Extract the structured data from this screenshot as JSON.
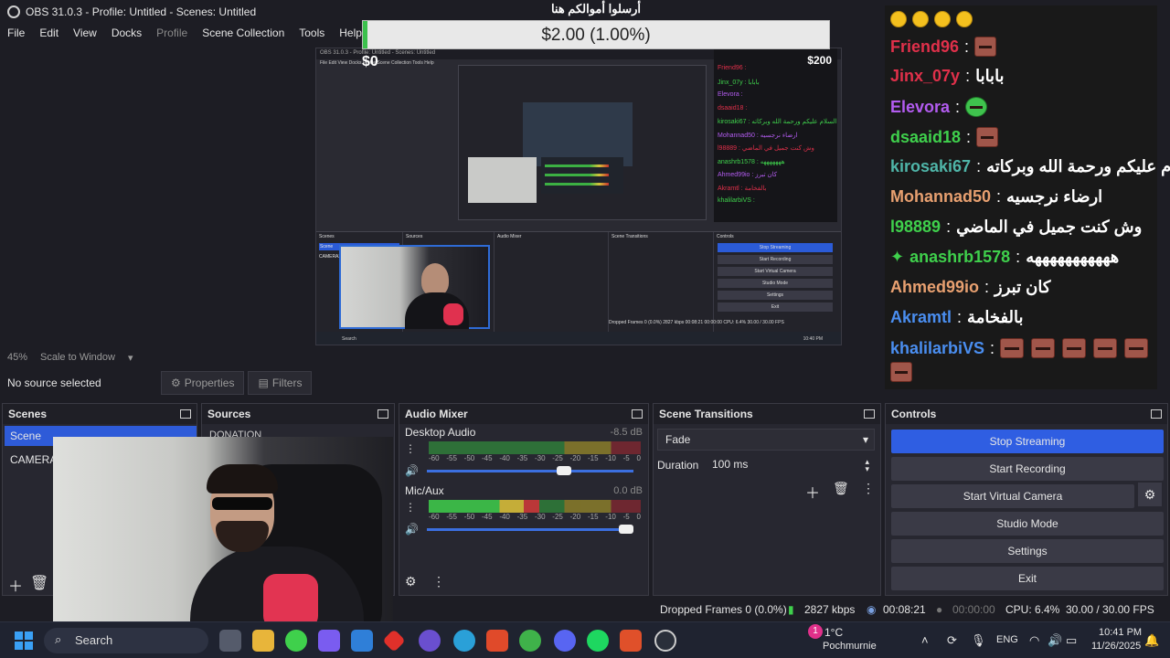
{
  "window": {
    "title": "OBS 31.0.3 - Profile: Untitled - Scenes: Untitled",
    "min": "—",
    "max": "☐",
    "close": "✕"
  },
  "menu": [
    "File",
    "Edit",
    "View",
    "Docks",
    "Profile",
    "Scene Collection",
    "Tools",
    "Help"
  ],
  "donation": {
    "title": "أرسلوا أموالكم هنا",
    "amount": "$2.00 (1.00%)",
    "progress": 0.01,
    "bar_color": "#3cc14d"
  },
  "preview": {
    "mini_title": "OBS 31.0.3 - Profile: Untitled - Scenes: Untitled",
    "mini_menu": "File  Edit  View  Docks  Profile  Scene Collection  Tools  Help",
    "goal_left": "$0",
    "goal_right": "$200",
    "mini_amount": "$2.00 (1.00%)",
    "mini_chat": [
      "Friend96 :",
      "Jinx_07y : بابابا",
      "Elevora :",
      "dsaaid18 :",
      "kirosaki67 : السلام عليكم ورحمة الله وبركاته",
      "Mohannad50 : ارضاء نرجسيه",
      "l98889 : وش كنت جميل في الماضي",
      "anashrb1578 : هههههههه",
      "Ahmed99io : كان تبرز",
      "Akramtl : بالفخامة",
      "khalilarbiVS :"
    ],
    "mini_panels": [
      "Scenes",
      "Sources",
      "Audio Mixer",
      "Scene Transitions",
      "Controls"
    ],
    "mini_controls": [
      "Stop Streaming",
      "Start Recording",
      "Start Virtual Camera",
      "Studio Mode",
      "Settings",
      "Exit"
    ],
    "mini_scenes": [
      "Scene",
      "CAMERA2"
    ],
    "mini_status": "Dropped Frames 0 (0.0%)   2827 kbps   00:08:21   00:00:00   CPU: 6.4%   30.00 / 30.00 FPS",
    "mini_search": "Search",
    "mini_clock": "10:40 PM"
  },
  "chat": [
    {
      "name": "Friend96",
      "color": "#e0304a",
      "msg": "",
      "emotes": 1
    },
    {
      "name": "Jinx_07y",
      "color": "#e0304a",
      "msg": "بابابا",
      "emotes": 0
    },
    {
      "name": "Elevora",
      "color": "#b35cf0",
      "msg": "",
      "emotes": 1,
      "green": true
    },
    {
      "name": "dsaaid18",
      "color": "#3fd04c",
      "msg": "",
      "emotes": 1
    },
    {
      "name": "kirosaki67",
      "color": "#4fb5a8",
      "msg": "السلام عليكم ورحمة الله وبركاته",
      "emotes": 0
    },
    {
      "name": "Mohannad50",
      "color": "#e8a070",
      "msg": "ارضاء نرجسيه",
      "emotes": 0
    },
    {
      "name": "l98889",
      "color": "#3fd04c",
      "msg": "وش كنت جميل في الماضي",
      "emotes": 0
    },
    {
      "name": "anashrb1578",
      "color": "#3fd04c",
      "msg": "هههههههههههه",
      "emotes": 0,
      "badge": true
    },
    {
      "name": "Ahmed99io",
      "color": "#e8a070",
      "msg": "كان تبرز",
      "emotes": 0
    },
    {
      "name": "Akramtl",
      "color": "#4a8ef0",
      "msg": "بالفخامة",
      "emotes": 0
    },
    {
      "name": "khalilarbiVS",
      "color": "#4a8ef0",
      "msg": "",
      "emotes": 5
    }
  ],
  "chat_laugh_count": 4,
  "zoom": {
    "level": "45%",
    "mode": "Scale to Window"
  },
  "source_toolbar": {
    "no_source": "No source selected",
    "properties": "Properties",
    "filters": "Filters"
  },
  "scenes": {
    "title": "Scenes",
    "items": [
      "Scene",
      "CAMERA2"
    ],
    "selected": 0
  },
  "sources": {
    "title": "Sources",
    "partial_item": "DONATION"
  },
  "audio": {
    "title": "Audio Mixer",
    "channels": [
      {
        "name": "Desktop Audio",
        "db": "-8.5 dB",
        "level": 0,
        "volume": 0.7
      },
      {
        "name": "Mic/Aux",
        "db": "0.0 dB",
        "level": 0.52,
        "volume": 1.0
      }
    ],
    "scale": [
      "-60",
      "-55",
      "-50",
      "-45",
      "-40",
      "-35",
      "-30",
      "-25",
      "-20",
      "-15",
      "-10",
      "-5",
      "0"
    ]
  },
  "transitions": {
    "title": "Scene Transitions",
    "selected": "Fade",
    "duration_label": "Duration",
    "duration": "100 ms"
  },
  "controls": {
    "title": "Controls",
    "buttons": [
      "Stop Streaming",
      "Start Recording",
      "Start Virtual Camera",
      "Studio Mode",
      "Settings",
      "Exit"
    ]
  },
  "status": {
    "dropped": "Dropped Frames 0 (0.0%)",
    "kbps": "2827 kbps",
    "stream_time": "00:08:21",
    "rec_time": "00:00:00",
    "cpu": "CPU: 6.4%",
    "fps": "30.00 / 30.00 FPS"
  },
  "taskbar": {
    "search": "Search",
    "weather_temp": "1°C",
    "weather_place": "Pochmurnie",
    "weather_badge": "1",
    "lang": "ENG",
    "time": "10:41 PM",
    "date": "11/26/2025"
  }
}
